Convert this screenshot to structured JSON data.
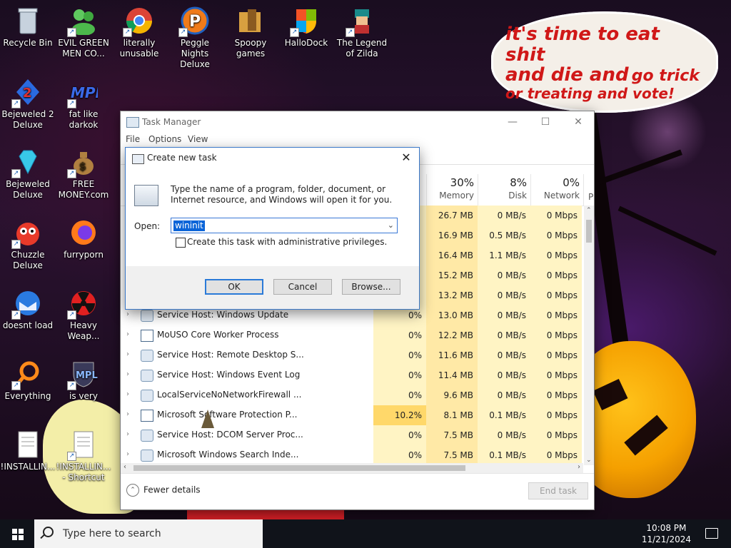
{
  "desktop": {
    "bubble": {
      "line1": "it's time to eat shit",
      "line2a": "and die and",
      "line2b": "go trick",
      "line3": "or treating and vote!"
    },
    "icons": [
      {
        "label": "Recycle Bin",
        "icon": "recycle-bin-icon"
      },
      {
        "label": "EVIL GREEN MEN CO...",
        "icon": "green-men-icon"
      },
      {
        "label": "literally unusable",
        "icon": "chrome-icon"
      },
      {
        "label": "Peggle Nights Deluxe",
        "icon": "peggle-icon"
      },
      {
        "label": "Spoopy games",
        "icon": "folder-icon"
      },
      {
        "label": "HalloDock",
        "icon": "windows-shield-icon"
      },
      {
        "label": "The Legend of Zilda",
        "icon": "zilda-icon"
      },
      {
        "label": "Bejeweled 2 Deluxe",
        "icon": "bejeweled2-icon"
      },
      {
        "label": "fat like darkok",
        "icon": "mpl-icon"
      },
      {
        "label": "Bejeweled Deluxe",
        "icon": "diamond-icon"
      },
      {
        "label": "FREE MONEY.com",
        "icon": "money-bag-icon"
      },
      {
        "label": "Chuzzle Deluxe",
        "icon": "chuzzle-icon"
      },
      {
        "label": "furryporn",
        "icon": "firefox-icon"
      },
      {
        "label": "doesnt load",
        "icon": "thunderbird-icon"
      },
      {
        "label": "Heavy Weap...",
        "icon": "radiation-icon"
      },
      {
        "label": "Everything",
        "icon": "everything-icon"
      },
      {
        "label": "is very",
        "icon": "shield-mpl-icon"
      },
      {
        "label": "!INSTALLIN...",
        "icon": "text-file-icon"
      },
      {
        "label": "!INSTALLIN... - Shortcut",
        "icon": "text-file-shortcut-icon"
      }
    ]
  },
  "taskmanager": {
    "title": "Task Manager",
    "menu": [
      "File",
      "Options",
      "View"
    ],
    "columns": {
      "memory": {
        "pct": "30%",
        "label": "Memory"
      },
      "disk": {
        "pct": "8%",
        "label": "Disk"
      },
      "network": {
        "pct": "0%",
        "label": "Network"
      },
      "partial": "P"
    },
    "rows": [
      {
        "name": "",
        "cpu": "",
        "mem": "26.7 MB",
        "disk": "0 MB/s",
        "net": "0 Mbps"
      },
      {
        "name": "",
        "cpu": "",
        "mem": "16.9 MB",
        "disk": "0.5 MB/s",
        "net": "0 Mbps"
      },
      {
        "name": "",
        "cpu": "",
        "mem": "16.4 MB",
        "disk": "1.1 MB/s",
        "net": "0 Mbps"
      },
      {
        "name": "",
        "cpu": "",
        "mem": "15.2 MB",
        "disk": "0 MB/s",
        "net": "0 Mbps"
      },
      {
        "name": "",
        "cpu": "",
        "mem": "13.2 MB",
        "disk": "0 MB/s",
        "net": "0 Mbps"
      },
      {
        "name": "Service Host: Windows Update",
        "cpu": "0%",
        "mem": "13.0 MB",
        "disk": "0 MB/s",
        "net": "0 Mbps"
      },
      {
        "name": "MoUSO Core Worker Process",
        "cpu": "0%",
        "mem": "12.2 MB",
        "disk": "0 MB/s",
        "net": "0 Mbps"
      },
      {
        "name": "Service Host: Remote Desktop S...",
        "cpu": "0%",
        "mem": "11.6 MB",
        "disk": "0 MB/s",
        "net": "0 Mbps"
      },
      {
        "name": "Service Host: Windows Event Log",
        "cpu": "0%",
        "mem": "11.4 MB",
        "disk": "0 MB/s",
        "net": "0 Mbps"
      },
      {
        "name": "LocalServiceNoNetworkFirewall ...",
        "cpu": "0%",
        "mem": "9.6 MB",
        "disk": "0 MB/s",
        "net": "0 Mbps"
      },
      {
        "name": "Microsoft Software Protection P...",
        "cpu": "10.2%",
        "mem": "8.1 MB",
        "disk": "0.1 MB/s",
        "net": "0 Mbps"
      },
      {
        "name": "Service Host: DCOM Server Proc...",
        "cpu": "0%",
        "mem": "7.5 MB",
        "disk": "0 MB/s",
        "net": "0 Mbps"
      },
      {
        "name": "Microsoft Windows Search Inde...",
        "cpu": "0%",
        "mem": "7.5 MB",
        "disk": "0.1 MB/s",
        "net": "0 Mbps"
      }
    ],
    "fewer_details": "Fewer details",
    "end_task": "End task"
  },
  "run": {
    "title": "Create new task",
    "description": "Type the name of a program, folder, document, or Internet resource, and Windows will open it for you.",
    "open_label": "Open:",
    "open_value": "wininit",
    "admin_label": "Create this task with administrative privileges.",
    "ok": "OK",
    "cancel": "Cancel",
    "browse": "Browse..."
  },
  "taskbar": {
    "search_placeholder": "Type here to search",
    "time": "10:08 PM",
    "date": "11/21/2024"
  }
}
